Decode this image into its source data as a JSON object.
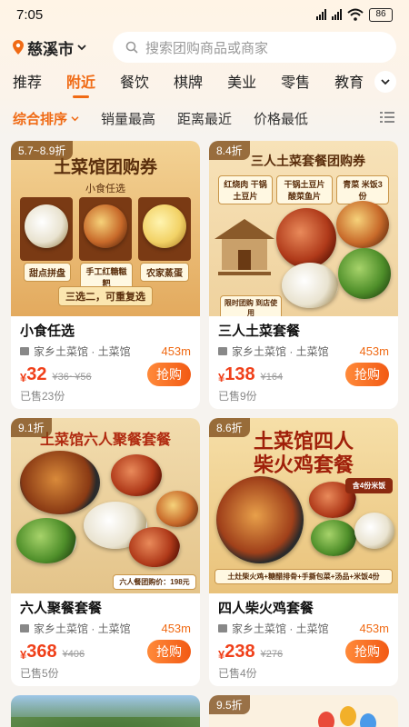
{
  "status_bar": {
    "time": "7:05",
    "battery": "86"
  },
  "location": {
    "city": "慈溪市"
  },
  "search": {
    "placeholder": "搜索团购商品或商家"
  },
  "categories": [
    "推荐",
    "附近",
    "餐饮",
    "棋牌",
    "美业",
    "零售",
    "教育"
  ],
  "active_category": "附近",
  "sort_options": [
    "综合排序",
    "销量最高",
    "距离最近",
    "价格最低"
  ],
  "active_sort": "综合排序",
  "currency_symbol": "¥",
  "buy_label": "抢购",
  "deals": [
    {
      "badge": "5.7~8.9折",
      "image_title": "土菜馆团购券",
      "image_subtitle": "小食任选",
      "image_labels": [
        "甜点拼盘",
        "手工红糖糍粑",
        "农家蒸蛋"
      ],
      "image_note": "三选二，可重复选",
      "title": "小食任选",
      "shop": "家乡土菜馆 · 土菜馆",
      "distance": "453m",
      "price": "32",
      "original_price": "¥36~¥56",
      "sold": "已售23份"
    },
    {
      "badge": "8.4折",
      "image_title": "三人土菜套餐团购券",
      "image_labels": [
        "红烧肉 干锅土豆片",
        "干锅土豆片 酸菜鱼片",
        "青菜 米饭3份"
      ],
      "image_note": "限时团购  到店使用",
      "title": "三人土菜套餐",
      "shop": "家乡土菜馆 · 土菜馆",
      "distance": "453m",
      "price": "138",
      "original_price": "¥164",
      "sold": "已售9份"
    },
    {
      "badge": "9.1折",
      "image_title": "土菜馆六人聚餐套餐",
      "image_note": "六人餐团购价：198元",
      "title": "六人聚餐套餐",
      "shop": "家乡土菜馆 · 土菜馆",
      "distance": "453m",
      "price": "368",
      "original_price": "¥406",
      "sold": "已售5份"
    },
    {
      "badge": "8.6折",
      "image_title": "土菜馆四人",
      "image_subtitle": "柴火鸡套餐",
      "image_labels": [
        "含4份米饭"
      ],
      "image_note": "土灶柴火鸡+糖醋排骨+手撕包菜+汤品+米饭4份",
      "title": "四人柴火鸡套餐",
      "shop": "家乡土菜馆 · 土菜馆",
      "distance": "453m",
      "price": "238",
      "original_price": "¥276",
      "sold": "已售4份"
    },
    {
      "badge": ""
    },
    {
      "badge": "9.5折"
    }
  ]
}
